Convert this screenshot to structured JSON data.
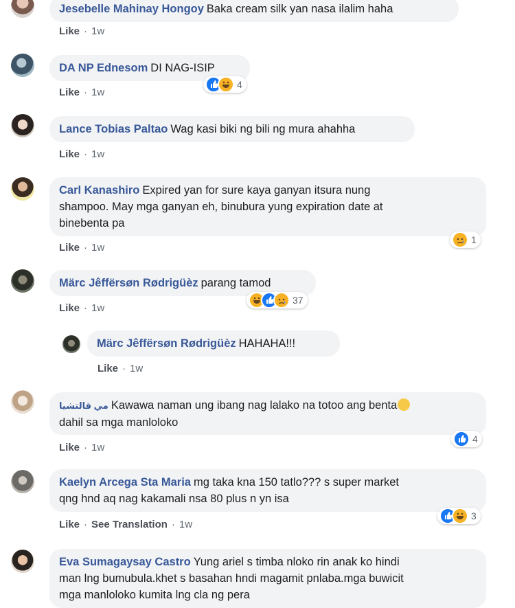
{
  "comments": [
    {
      "name": "Jesebelle Mahinay Hongoy",
      "text": "Baka cream silk yan nasa ilalim haha",
      "like": "Like",
      "time": "1w"
    },
    {
      "name": "DA NP Ednesom",
      "text": "DI NAG-ISIP",
      "like": "Like",
      "time": "1w",
      "count": "4"
    },
    {
      "name": "Lance Tobias Paltao",
      "text": "Wag kasi biki ng bili ng mura ahahha",
      "like": "Like",
      "time": "1w"
    },
    {
      "name": "Carl Kanashiro",
      "text1": "Expired yan for sure kaya ganyan itsura nung",
      "text2": "shampoo. May mga ganyan eh, binubura yung expiration date at",
      "text3": "binebenta pa",
      "like": "Like",
      "time": "1w",
      "count": "1"
    },
    {
      "name": "Märc Jêffërsøn Rødrigüèz",
      "text": "parang tamod",
      "like": "Like",
      "time": "1w",
      "count": "37"
    },
    {
      "name": "Märc Jêffërsøn Rødrigüèz",
      "text": "HAHAHA!!!",
      "like": "Like",
      "time": "1w"
    },
    {
      "name": "مي قالتشيا",
      "text1": "Kawawa naman ung ibang nag lalako na totoo ang benta",
      "text2": "dahil sa mga manloloko",
      "like": "Like",
      "time": "1w",
      "count": "4"
    },
    {
      "name": "Kaelyn Arcega Sta Maria",
      "text1": "mg taka kna 150 tatlo??? s super market",
      "text2": "qng hnd aq nag kakamali nsa 80 plus n yn isa",
      "like": "Like",
      "translate": "See Translation",
      "time": "1w",
      "count": "3"
    },
    {
      "name": "Eva Sumagaysay Castro",
      "text1": "Yung ariel s timba nloko rin anak ko hindi",
      "text2": "man lng bumubula.khet s basahan hndi magamit pnlaba.mga buwicit",
      "text3": "mga manloloko kumita lng cla ng pera"
    }
  ],
  "colors": {
    "name": "#385898",
    "bubble": "#f2f3f5",
    "like": "#1877f2",
    "haha": "#f7b125"
  }
}
